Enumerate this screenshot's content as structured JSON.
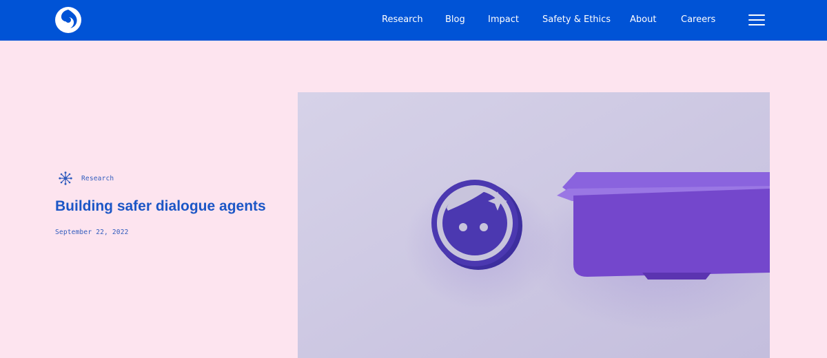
{
  "header": {
    "logo_name": "deepmind-logo",
    "nav": [
      {
        "label": "Research"
      },
      {
        "label": "Blog"
      },
      {
        "label": "Impact"
      },
      {
        "label": "Safety & Ethics"
      },
      {
        "label": "About"
      },
      {
        "label": "Careers"
      }
    ],
    "menu_icon": "hamburger-menu-icon"
  },
  "article": {
    "category": "Research",
    "category_icon": "network-icon",
    "title": "Building safer dialogue agents",
    "date": "September 22, 2022"
  },
  "hero_image": {
    "subject": "face-badge-and-speech-bubble-icon"
  },
  "colors": {
    "header_bg": "#0053d6",
    "page_bg": "#fde4ef",
    "title_text": "#1c56c6",
    "meta_text": "#2f5bbd",
    "hero_bg": "#cdc8e2",
    "badge_purple": "#4b38b0",
    "bubble_purple": "#7447cc"
  }
}
